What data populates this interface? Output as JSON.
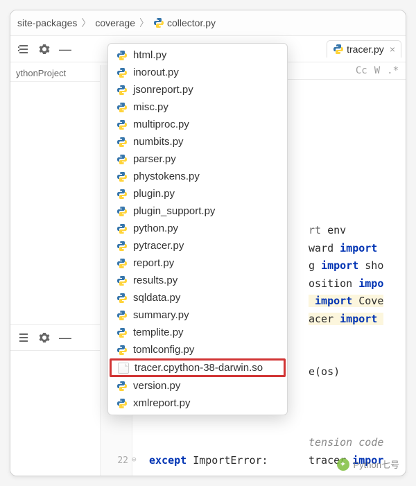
{
  "breadcrumb": {
    "items": [
      {
        "label": "site-packages",
        "type": "folder"
      },
      {
        "label": "coverage",
        "type": "folder"
      },
      {
        "label": "collector.py",
        "type": "python"
      }
    ]
  },
  "sidebar": {
    "project_label": "ythonProject"
  },
  "tabs": {
    "open": {
      "name": "tracer.py"
    }
  },
  "search_options": {
    "cc": "Cc",
    "w": "W",
    "regex": ".*"
  },
  "dropdown": {
    "items": [
      {
        "label": "html.py",
        "icon": "python"
      },
      {
        "label": "inorout.py",
        "icon": "python"
      },
      {
        "label": "jsonreport.py",
        "icon": "python"
      },
      {
        "label": "misc.py",
        "icon": "python"
      },
      {
        "label": "multiproc.py",
        "icon": "python"
      },
      {
        "label": "numbits.py",
        "icon": "python"
      },
      {
        "label": "parser.py",
        "icon": "python"
      },
      {
        "label": "phystokens.py",
        "icon": "python"
      },
      {
        "label": "plugin.py",
        "icon": "python"
      },
      {
        "label": "plugin_support.py",
        "icon": "python"
      },
      {
        "label": "python.py",
        "icon": "python"
      },
      {
        "label": "pytracer.py",
        "icon": "python"
      },
      {
        "label": "report.py",
        "icon": "python"
      },
      {
        "label": "results.py",
        "icon": "python"
      },
      {
        "label": "sqldata.py",
        "icon": "python"
      },
      {
        "label": "summary.py",
        "icon": "python"
      },
      {
        "label": "templite.py",
        "icon": "python"
      },
      {
        "label": "tomlconfig.py",
        "icon": "python"
      },
      {
        "label": "tracer.cpython-38-darwin.so",
        "icon": "file",
        "highlight": true
      },
      {
        "label": "version.py",
        "icon": "python"
      },
      {
        "label": "xmlreport.py",
        "icon": "python"
      }
    ]
  },
  "editor": {
    "visible_lines": {
      "l1": "rt env",
      "l2": "ward import ",
      "l3": "g import sho",
      "l4": "osition impo",
      "l5": " import Cove",
      "l6": "acer import ",
      "l7": "e(os)",
      "l8": "tension code",
      "l9": "tracer impor",
      "except": "except ImportError:"
    },
    "line_number": "22"
  },
  "watermark": {
    "text": "Python七号"
  }
}
